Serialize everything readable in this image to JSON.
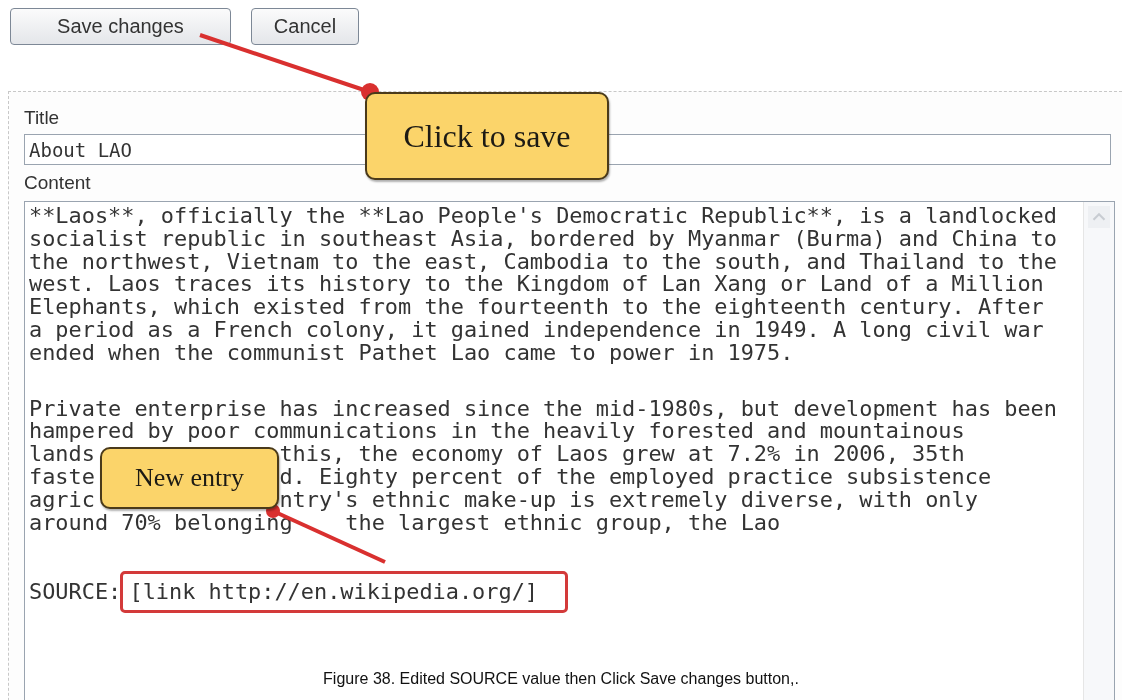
{
  "buttons": [
    {
      "label": "Save changes"
    },
    {
      "label": "Cancel"
    }
  ],
  "title_field": {
    "label": "Title",
    "value": "About LAO"
  },
  "content_field": {
    "label": "Content",
    "lines": [
      {
        "kind": "text",
        "text": "**Laos**, officially the **Lao People's Democratic Republic**, is a landlocked"
      },
      {
        "kind": "text",
        "text": "socialist republic in southeast Asia, bordered by Myanmar (Burma) and China to"
      },
      {
        "kind": "text",
        "text": "the northwest, Vietnam to the east, Cambodia to the south, and Thailand to the"
      },
      {
        "kind": "text",
        "text": "west. Laos traces its history to the Kingdom of Lan Xang or Land of a Million"
      },
      {
        "kind": "text",
        "text": "Elephants, which existed from the fourteenth to the eighteenth century. After"
      },
      {
        "kind": "text",
        "text": "a period as a French colony, it gained independence in 1949. A long civil war"
      },
      {
        "kind": "text",
        "text": "ended when the communist Pathet Lao came to power in 1975."
      },
      {
        "kind": "blank"
      },
      {
        "kind": "text",
        "text": "Private enterprise has increased since the mid-1980s, but development has been"
      },
      {
        "kind": "text",
        "text": "hampered by poor communications in the heavily forested and mountainous"
      },
      {
        "kind": "covered",
        "before": "lands",
        "after": "this, the economy of Laos grew at 7.2% in 2006, 35th"
      },
      {
        "kind": "covered",
        "before": "faste",
        "after": "d. Eighty percent of the employed practice subsistence"
      },
      {
        "kind": "covered",
        "before": "agric",
        "after": "ntry's ethnic make-up is extremely diverse, with only"
      },
      {
        "kind": "covered",
        "before": "around 70% belonging",
        "after": "the largest ethnic group, the Lao"
      },
      {
        "kind": "blank"
      },
      {
        "kind": "source",
        "label": "SOURCE:",
        "value": "[link http://en.wikipedia.org/]"
      }
    ]
  },
  "callouts": [
    {
      "text": "Click to save"
    },
    {
      "text": "New entry"
    }
  ],
  "caption": "Figure 38. Edited SOURCE value then Click Save changes button,."
}
